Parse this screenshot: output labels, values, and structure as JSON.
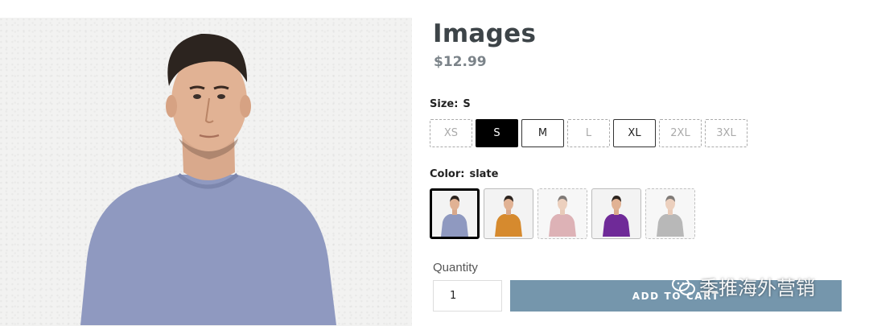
{
  "product": {
    "title": "Images",
    "price": "$12.99"
  },
  "size": {
    "label": "Size:",
    "selected": "S",
    "options": [
      {
        "label": "XS",
        "state": "unavailable"
      },
      {
        "label": "S",
        "state": "selected"
      },
      {
        "label": "M",
        "state": "available"
      },
      {
        "label": "L",
        "state": "unavailable"
      },
      {
        "label": "XL",
        "state": "available"
      },
      {
        "label": "2XL",
        "state": "unavailable"
      },
      {
        "label": "3XL",
        "state": "unavailable"
      }
    ]
  },
  "color": {
    "label": "Color:",
    "selected": "slate",
    "swatches": [
      {
        "shirt_color": "#8f99c0",
        "state": "selected"
      },
      {
        "shirt_color": "#d68a2e",
        "state": "available"
      },
      {
        "shirt_color": "#c77f86",
        "state": "unavailable"
      },
      {
        "shirt_color": "#6f2a98",
        "state": "available"
      },
      {
        "shirt_color": "#8a8a8a",
        "state": "unavailable"
      }
    ]
  },
  "quantity": {
    "label": "Quantity",
    "value": "1"
  },
  "add_to_cart_label": "ADD TO CART",
  "watermark": {
    "text": "季推海外营销",
    "icon": "wechat-icon"
  },
  "colors": {
    "accent_button": "#7596ac",
    "title": "#3d4448",
    "price": "#7b8389"
  }
}
